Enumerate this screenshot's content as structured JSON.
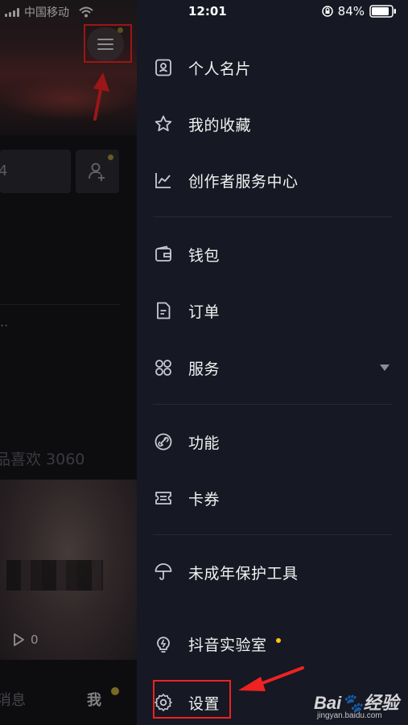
{
  "status_bar": {
    "carrier": "中国移动",
    "time": "12:01",
    "battery": "84%"
  },
  "profile_background": {
    "likes": "品喜欢 3060",
    "video_play_count": "0",
    "tabs": {
      "messages": "消息",
      "me": "我"
    }
  },
  "drawer": {
    "items": [
      {
        "label": "个人名片",
        "icon": "id-card-icon"
      },
      {
        "label": "我的收藏",
        "icon": "star-icon"
      },
      {
        "label": "创作者服务中心",
        "icon": "chart-line-icon"
      },
      {
        "label": "钱包",
        "icon": "wallet-icon"
      },
      {
        "label": "订单",
        "icon": "document-icon"
      },
      {
        "label": "服务",
        "icon": "grid-icon"
      },
      {
        "label": "功能",
        "icon": "link-icon"
      },
      {
        "label": "卡券",
        "icon": "ticket-icon"
      },
      {
        "label": "未成年保护工具",
        "icon": "umbrella-icon"
      },
      {
        "label": "抖音实验室",
        "icon": "lightbulb-icon"
      },
      {
        "label": "设置",
        "icon": "gear-icon"
      }
    ]
  },
  "watermark": {
    "brand": "Bai",
    "brand_suffix": "经验",
    "domain": "jingyan.baidu.com"
  },
  "colors": {
    "drawer_bg": "#161823",
    "annotation_red": "#ee2222",
    "notification_dot": "#f5c518"
  }
}
